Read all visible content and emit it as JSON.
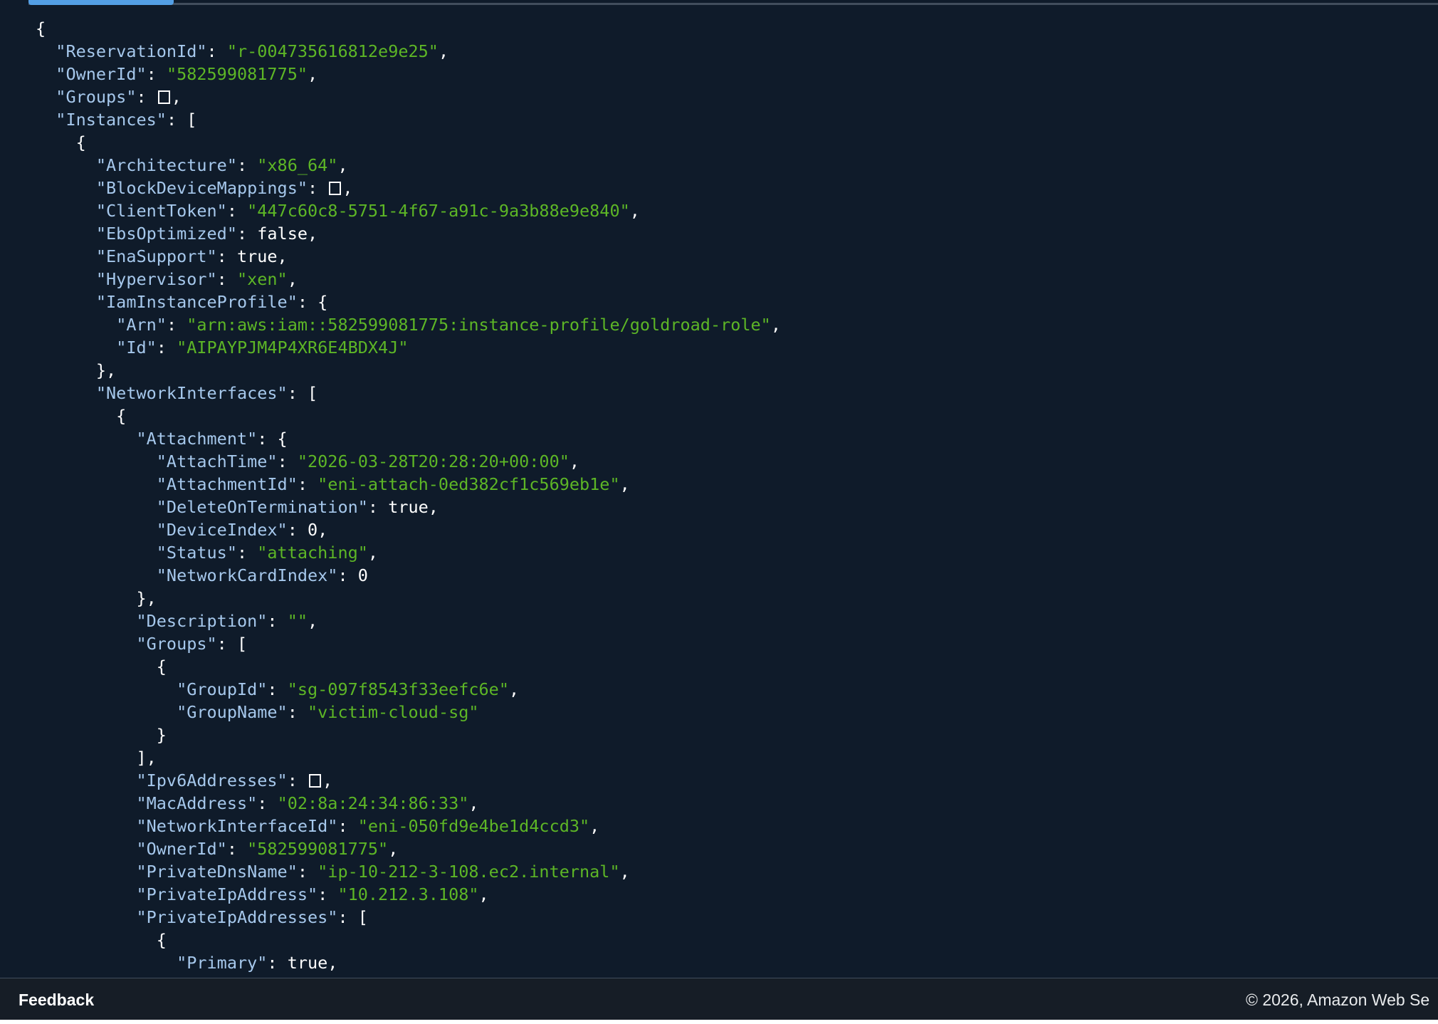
{
  "colors": {
    "background": "#0f1b2a",
    "json_key": "#a6c8ec",
    "json_string": "#5db626",
    "json_punctuation": "#ffffff",
    "progress_accent": "#539fe5",
    "footer_background": "#161d26"
  },
  "output": {
    "truncated_line_top": "- -",
    "lines": [
      {
        "t": [
          [
            "p",
            "{"
          ]
        ]
      },
      {
        "t": [
          [
            "p",
            "  "
          ],
          [
            "k",
            "\"ReservationId\""
          ],
          [
            "p",
            ": "
          ],
          [
            "s",
            "\"r-004735616812e9e25\""
          ],
          [
            "p",
            ","
          ]
        ]
      },
      {
        "t": [
          [
            "p",
            "  "
          ],
          [
            "k",
            "\"OwnerId\""
          ],
          [
            "p",
            ": "
          ],
          [
            "s",
            "\"582599081775\""
          ],
          [
            "p",
            ","
          ]
        ]
      },
      {
        "t": [
          [
            "p",
            "  "
          ],
          [
            "k",
            "\"Groups\""
          ],
          [
            "p",
            ": "
          ],
          [
            "e",
            ""
          ],
          [
            "p",
            ","
          ]
        ]
      },
      {
        "t": [
          [
            "p",
            "  "
          ],
          [
            "k",
            "\"Instances\""
          ],
          [
            "p",
            ": ["
          ]
        ]
      },
      {
        "t": [
          [
            "p",
            "    {"
          ]
        ]
      },
      {
        "t": [
          [
            "p",
            "      "
          ],
          [
            "k",
            "\"Architecture\""
          ],
          [
            "p",
            ": "
          ],
          [
            "s",
            "\"x86_64\""
          ],
          [
            "p",
            ","
          ]
        ]
      },
      {
        "t": [
          [
            "p",
            "      "
          ],
          [
            "k",
            "\"BlockDeviceMappings\""
          ],
          [
            "p",
            ": "
          ],
          [
            "e",
            ""
          ],
          [
            "p",
            ","
          ]
        ]
      },
      {
        "t": [
          [
            "p",
            "      "
          ],
          [
            "k",
            "\"ClientToken\""
          ],
          [
            "p",
            ": "
          ],
          [
            "s",
            "\"447c60c8-5751-4f67-a91c-9a3b88e9e840\""
          ],
          [
            "p",
            ","
          ]
        ]
      },
      {
        "t": [
          [
            "p",
            "      "
          ],
          [
            "k",
            "\"EbsOptimized\""
          ],
          [
            "p",
            ": false,"
          ]
        ]
      },
      {
        "t": [
          [
            "p",
            "      "
          ],
          [
            "k",
            "\"EnaSupport\""
          ],
          [
            "p",
            ": true,"
          ]
        ]
      },
      {
        "t": [
          [
            "p",
            "      "
          ],
          [
            "k",
            "\"Hypervisor\""
          ],
          [
            "p",
            ": "
          ],
          [
            "s",
            "\"xen\""
          ],
          [
            "p",
            ","
          ]
        ]
      },
      {
        "t": [
          [
            "p",
            "      "
          ],
          [
            "k",
            "\"IamInstanceProfile\""
          ],
          [
            "p",
            ": {"
          ]
        ]
      },
      {
        "t": [
          [
            "p",
            "        "
          ],
          [
            "k",
            "\"Arn\""
          ],
          [
            "p",
            ": "
          ],
          [
            "s",
            "\"arn:aws:iam::582599081775:instance-profile/goldroad-role\""
          ],
          [
            "p",
            ","
          ]
        ]
      },
      {
        "t": [
          [
            "p",
            "        "
          ],
          [
            "k",
            "\"Id\""
          ],
          [
            "p",
            ": "
          ],
          [
            "s",
            "\"AIPAYPJM4P4XR6E4BDX4J\""
          ]
        ]
      },
      {
        "t": [
          [
            "p",
            "      },"
          ]
        ]
      },
      {
        "t": [
          [
            "p",
            "      "
          ],
          [
            "k",
            "\"NetworkInterfaces\""
          ],
          [
            "p",
            ": ["
          ]
        ]
      },
      {
        "t": [
          [
            "p",
            "        {"
          ]
        ]
      },
      {
        "t": [
          [
            "p",
            "          "
          ],
          [
            "k",
            "\"Attachment\""
          ],
          [
            "p",
            ": {"
          ]
        ]
      },
      {
        "t": [
          [
            "p",
            "            "
          ],
          [
            "k",
            "\"AttachTime\""
          ],
          [
            "p",
            ": "
          ],
          [
            "s",
            "\"2026-03-28T20:28:20+00:00\""
          ],
          [
            "p",
            ","
          ]
        ]
      },
      {
        "t": [
          [
            "p",
            "            "
          ],
          [
            "k",
            "\"AttachmentId\""
          ],
          [
            "p",
            ": "
          ],
          [
            "s",
            "\"eni-attach-0ed382cf1c569eb1e\""
          ],
          [
            "p",
            ","
          ]
        ]
      },
      {
        "t": [
          [
            "p",
            "            "
          ],
          [
            "k",
            "\"DeleteOnTermination\""
          ],
          [
            "p",
            ": true,"
          ]
        ]
      },
      {
        "t": [
          [
            "p",
            "            "
          ],
          [
            "k",
            "\"DeviceIndex\""
          ],
          [
            "p",
            ": 0,"
          ]
        ]
      },
      {
        "t": [
          [
            "p",
            "            "
          ],
          [
            "k",
            "\"Status\""
          ],
          [
            "p",
            ": "
          ],
          [
            "s",
            "\"attaching\""
          ],
          [
            "p",
            ","
          ]
        ]
      },
      {
        "t": [
          [
            "p",
            "            "
          ],
          [
            "k",
            "\"NetworkCardIndex\""
          ],
          [
            "p",
            ": 0"
          ]
        ]
      },
      {
        "t": [
          [
            "p",
            "          },"
          ]
        ]
      },
      {
        "t": [
          [
            "p",
            "          "
          ],
          [
            "k",
            "\"Description\""
          ],
          [
            "p",
            ": "
          ],
          [
            "s",
            "\"\""
          ],
          [
            "p",
            ","
          ]
        ]
      },
      {
        "t": [
          [
            "p",
            "          "
          ],
          [
            "k",
            "\"Groups\""
          ],
          [
            "p",
            ": ["
          ]
        ]
      },
      {
        "t": [
          [
            "p",
            "            {"
          ]
        ]
      },
      {
        "t": [
          [
            "p",
            "              "
          ],
          [
            "k",
            "\"GroupId\""
          ],
          [
            "p",
            ": "
          ],
          [
            "s",
            "\"sg-097f8543f33eefc6e\""
          ],
          [
            "p",
            ","
          ]
        ]
      },
      {
        "t": [
          [
            "p",
            "              "
          ],
          [
            "k",
            "\"GroupName\""
          ],
          [
            "p",
            ": "
          ],
          [
            "s",
            "\"victim-cloud-sg\""
          ]
        ]
      },
      {
        "t": [
          [
            "p",
            "            }"
          ]
        ]
      },
      {
        "t": [
          [
            "p",
            "          ],"
          ]
        ]
      },
      {
        "t": [
          [
            "p",
            "          "
          ],
          [
            "k",
            "\"Ipv6Addresses\""
          ],
          [
            "p",
            ": "
          ],
          [
            "e",
            ""
          ],
          [
            "p",
            ","
          ]
        ]
      },
      {
        "t": [
          [
            "p",
            "          "
          ],
          [
            "k",
            "\"MacAddress\""
          ],
          [
            "p",
            ": "
          ],
          [
            "s",
            "\"02:8a:24:34:86:33\""
          ],
          [
            "p",
            ","
          ]
        ]
      },
      {
        "t": [
          [
            "p",
            "          "
          ],
          [
            "k",
            "\"NetworkInterfaceId\""
          ],
          [
            "p",
            ": "
          ],
          [
            "s",
            "\"eni-050fd9e4be1d4ccd3\""
          ],
          [
            "p",
            ","
          ]
        ]
      },
      {
        "t": [
          [
            "p",
            "          "
          ],
          [
            "k",
            "\"OwnerId\""
          ],
          [
            "p",
            ": "
          ],
          [
            "s",
            "\"582599081775\""
          ],
          [
            "p",
            ","
          ]
        ]
      },
      {
        "t": [
          [
            "p",
            "          "
          ],
          [
            "k",
            "\"PrivateDnsName\""
          ],
          [
            "p",
            ": "
          ],
          [
            "s",
            "\"ip-10-212-3-108.ec2.internal\""
          ],
          [
            "p",
            ","
          ]
        ]
      },
      {
        "t": [
          [
            "p",
            "          "
          ],
          [
            "k",
            "\"PrivateIpAddress\""
          ],
          [
            "p",
            ": "
          ],
          [
            "s",
            "\"10.212.3.108\""
          ],
          [
            "p",
            ","
          ]
        ]
      },
      {
        "t": [
          [
            "p",
            "          "
          ],
          [
            "k",
            "\"PrivateIpAddresses\""
          ],
          [
            "p",
            ": ["
          ]
        ]
      },
      {
        "t": [
          [
            "p",
            "            {"
          ]
        ]
      },
      {
        "t": [
          [
            "p",
            "              "
          ],
          [
            "k",
            "\"Primary\""
          ],
          [
            "p",
            ": true,"
          ]
        ]
      }
    ]
  },
  "footer": {
    "feedback_label": "Feedback",
    "copyright": "© 2026, Amazon Web Se"
  }
}
